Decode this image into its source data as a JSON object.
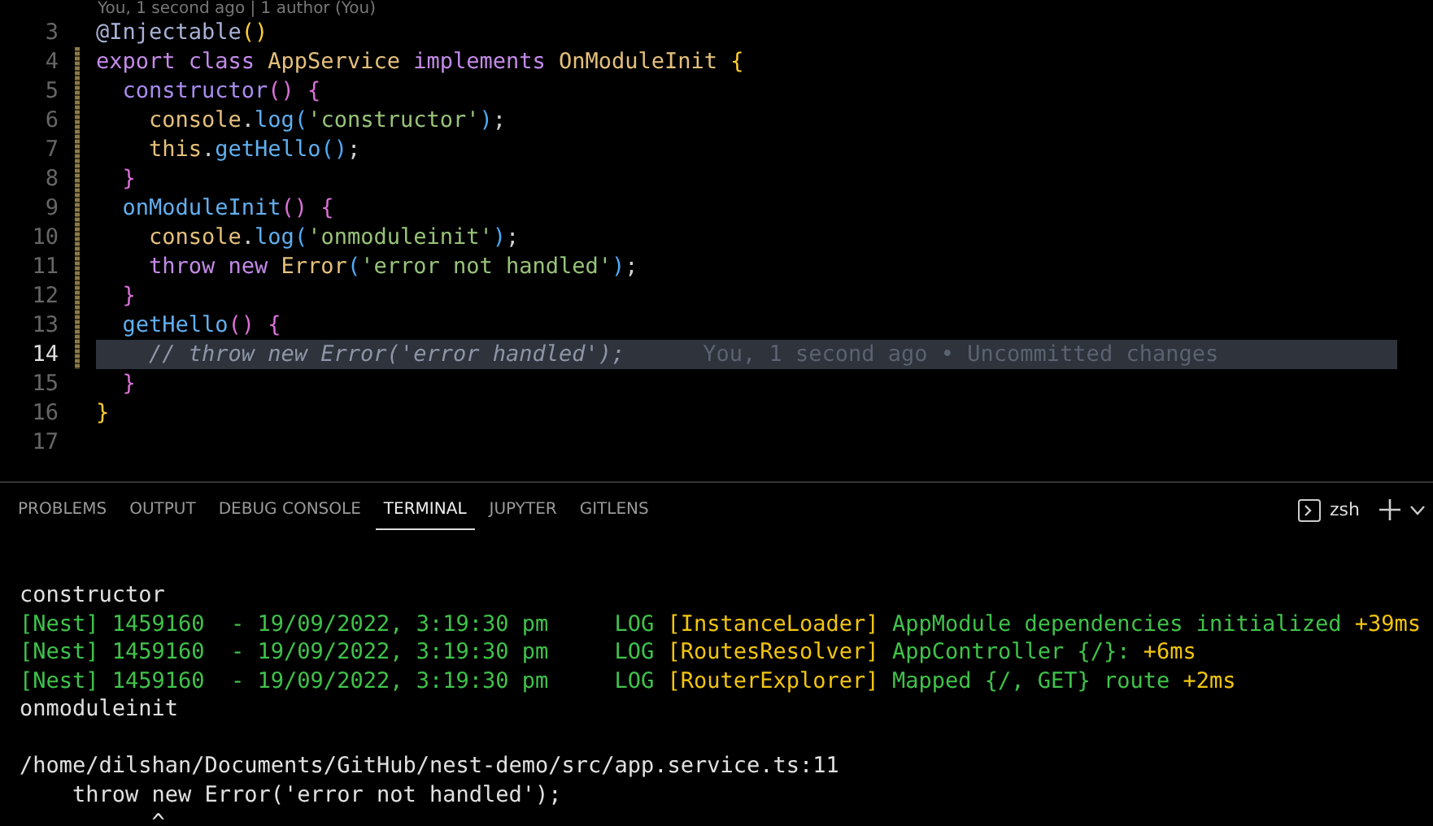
{
  "editor": {
    "codelens": "You, 1 second ago | 1 author (You)",
    "lines": [
      {
        "number": "3",
        "modified": false,
        "current": false,
        "tokens": [
          {
            "kind": "deco",
            "text": "@Injectable"
          },
          {
            "kind": "p1",
            "text": "()"
          }
        ]
      },
      {
        "number": "4",
        "modified": true,
        "current": false,
        "tokens": [
          {
            "kind": "kw",
            "text": "export class "
          },
          {
            "kind": "cls",
            "text": "AppService "
          },
          {
            "kind": "kw",
            "text": "implements "
          },
          {
            "kind": "cls",
            "text": "OnModuleInit "
          },
          {
            "kind": "p1",
            "text": "{"
          }
        ]
      },
      {
        "number": "5",
        "modified": true,
        "current": false,
        "tokens": [
          {
            "kind": "ctor",
            "text": "  constructor"
          },
          {
            "kind": "p2",
            "text": "() {"
          }
        ]
      },
      {
        "number": "6",
        "modified": true,
        "current": false,
        "tokens": [
          {
            "kind": "cls",
            "text": "    console"
          },
          {
            "kind": "plain",
            "text": "."
          },
          {
            "kind": "fn",
            "text": "log"
          },
          {
            "kind": "p3",
            "text": "("
          },
          {
            "kind": "str",
            "text": "'constructor'"
          },
          {
            "kind": "p3",
            "text": ")"
          },
          {
            "kind": "plain",
            "text": ";"
          }
        ]
      },
      {
        "number": "7",
        "modified": true,
        "current": false,
        "tokens": [
          {
            "kind": "cls",
            "text": "    this"
          },
          {
            "kind": "plain",
            "text": "."
          },
          {
            "kind": "fn",
            "text": "getHello"
          },
          {
            "kind": "p3",
            "text": "()"
          },
          {
            "kind": "plain",
            "text": ";"
          }
        ]
      },
      {
        "number": "8",
        "modified": true,
        "current": false,
        "tokens": [
          {
            "kind": "p2",
            "text": "  }"
          }
        ]
      },
      {
        "number": "9",
        "modified": true,
        "current": false,
        "tokens": [
          {
            "kind": "fn",
            "text": "  onModuleInit"
          },
          {
            "kind": "p2",
            "text": "() {"
          }
        ]
      },
      {
        "number": "10",
        "modified": true,
        "current": false,
        "tokens": [
          {
            "kind": "cls",
            "text": "    console"
          },
          {
            "kind": "plain",
            "text": "."
          },
          {
            "kind": "fn",
            "text": "log"
          },
          {
            "kind": "p3",
            "text": "("
          },
          {
            "kind": "str",
            "text": "'onmoduleinit'"
          },
          {
            "kind": "p3",
            "text": ")"
          },
          {
            "kind": "plain",
            "text": ";"
          }
        ]
      },
      {
        "number": "11",
        "modified": true,
        "current": false,
        "tokens": [
          {
            "kind": "kw",
            "text": "    throw new "
          },
          {
            "kind": "cls",
            "text": "Error"
          },
          {
            "kind": "p3",
            "text": "("
          },
          {
            "kind": "str",
            "text": "'error not handled'"
          },
          {
            "kind": "p3",
            "text": ")"
          },
          {
            "kind": "plain",
            "text": ";"
          }
        ]
      },
      {
        "number": "12",
        "modified": true,
        "current": false,
        "tokens": [
          {
            "kind": "p2",
            "text": "  }"
          }
        ]
      },
      {
        "number": "13",
        "modified": true,
        "current": false,
        "tokens": [
          {
            "kind": "fn",
            "text": "  getHello"
          },
          {
            "kind": "p2",
            "text": "() {"
          }
        ]
      },
      {
        "number": "14",
        "modified": true,
        "current": true,
        "blame": "You, 1 second ago • Uncommitted changes",
        "tokens": [
          {
            "kind": "comment",
            "text": "    // throw new Error('error handled');"
          }
        ]
      },
      {
        "number": "15",
        "modified": false,
        "current": false,
        "tokens": [
          {
            "kind": "p2",
            "text": "  }"
          }
        ]
      },
      {
        "number": "16",
        "modified": false,
        "current": false,
        "tokens": [
          {
            "kind": "p1",
            "text": "}"
          }
        ]
      },
      {
        "number": "17",
        "modified": false,
        "current": false
      }
    ]
  },
  "panel": {
    "tabs": [
      {
        "label": "PROBLEMS",
        "selected": false
      },
      {
        "label": "OUTPUT",
        "selected": false
      },
      {
        "label": "DEBUG CONSOLE",
        "selected": false
      },
      {
        "label": "TERMINAL",
        "selected": true
      },
      {
        "label": "JUPYTER",
        "selected": false
      },
      {
        "label": "GITLENS",
        "selected": false
      }
    ],
    "shell": "zsh",
    "terminal_lines": [
      {
        "kind": "text",
        "segments": [
          {
            "kind": "plain",
            "text": "constructor"
          }
        ]
      },
      {
        "kind": "text",
        "segments": [
          {
            "kind": "green",
            "text": "[Nest] 1459160  - 19/09/2022, 3:19:30 pm     LOG "
          },
          {
            "kind": "yellow",
            "text": "[InstanceLoader]"
          },
          {
            "kind": "green",
            "text": " AppModule dependencies initialized"
          },
          {
            "kind": "yellow",
            "text": " +39ms"
          }
        ]
      },
      {
        "kind": "text",
        "segments": [
          {
            "kind": "green",
            "text": "[Nest] 1459160  - 19/09/2022, 3:19:30 pm     LOG "
          },
          {
            "kind": "yellow",
            "text": "[RoutesResolver]"
          },
          {
            "kind": "green",
            "text": " AppController {/}:"
          },
          {
            "kind": "yellow",
            "text": " +6ms"
          }
        ]
      },
      {
        "kind": "text",
        "segments": [
          {
            "kind": "green",
            "text": "[Nest] 1459160  - 19/09/2022, 3:19:30 pm     LOG "
          },
          {
            "kind": "yellow",
            "text": "[RouterExplorer]"
          },
          {
            "kind": "green",
            "text": " Mapped {/, GET} route"
          },
          {
            "kind": "yellow",
            "text": " +2ms"
          }
        ]
      },
      {
        "kind": "text",
        "segments": [
          {
            "kind": "plain",
            "text": "onmoduleinit"
          }
        ]
      },
      {
        "kind": "blank"
      },
      {
        "kind": "text",
        "segments": [
          {
            "kind": "plain",
            "text": "/home/dilshan/Documents/GitHub/nest-demo/src/app.service.ts:11"
          }
        ]
      },
      {
        "kind": "text",
        "segments": [
          {
            "kind": "plain",
            "text": "    throw new Error('error not handled');"
          }
        ]
      },
      {
        "kind": "text",
        "segments": [
          {
            "kind": "plain",
            "text": "          ^"
          }
        ]
      }
    ]
  }
}
